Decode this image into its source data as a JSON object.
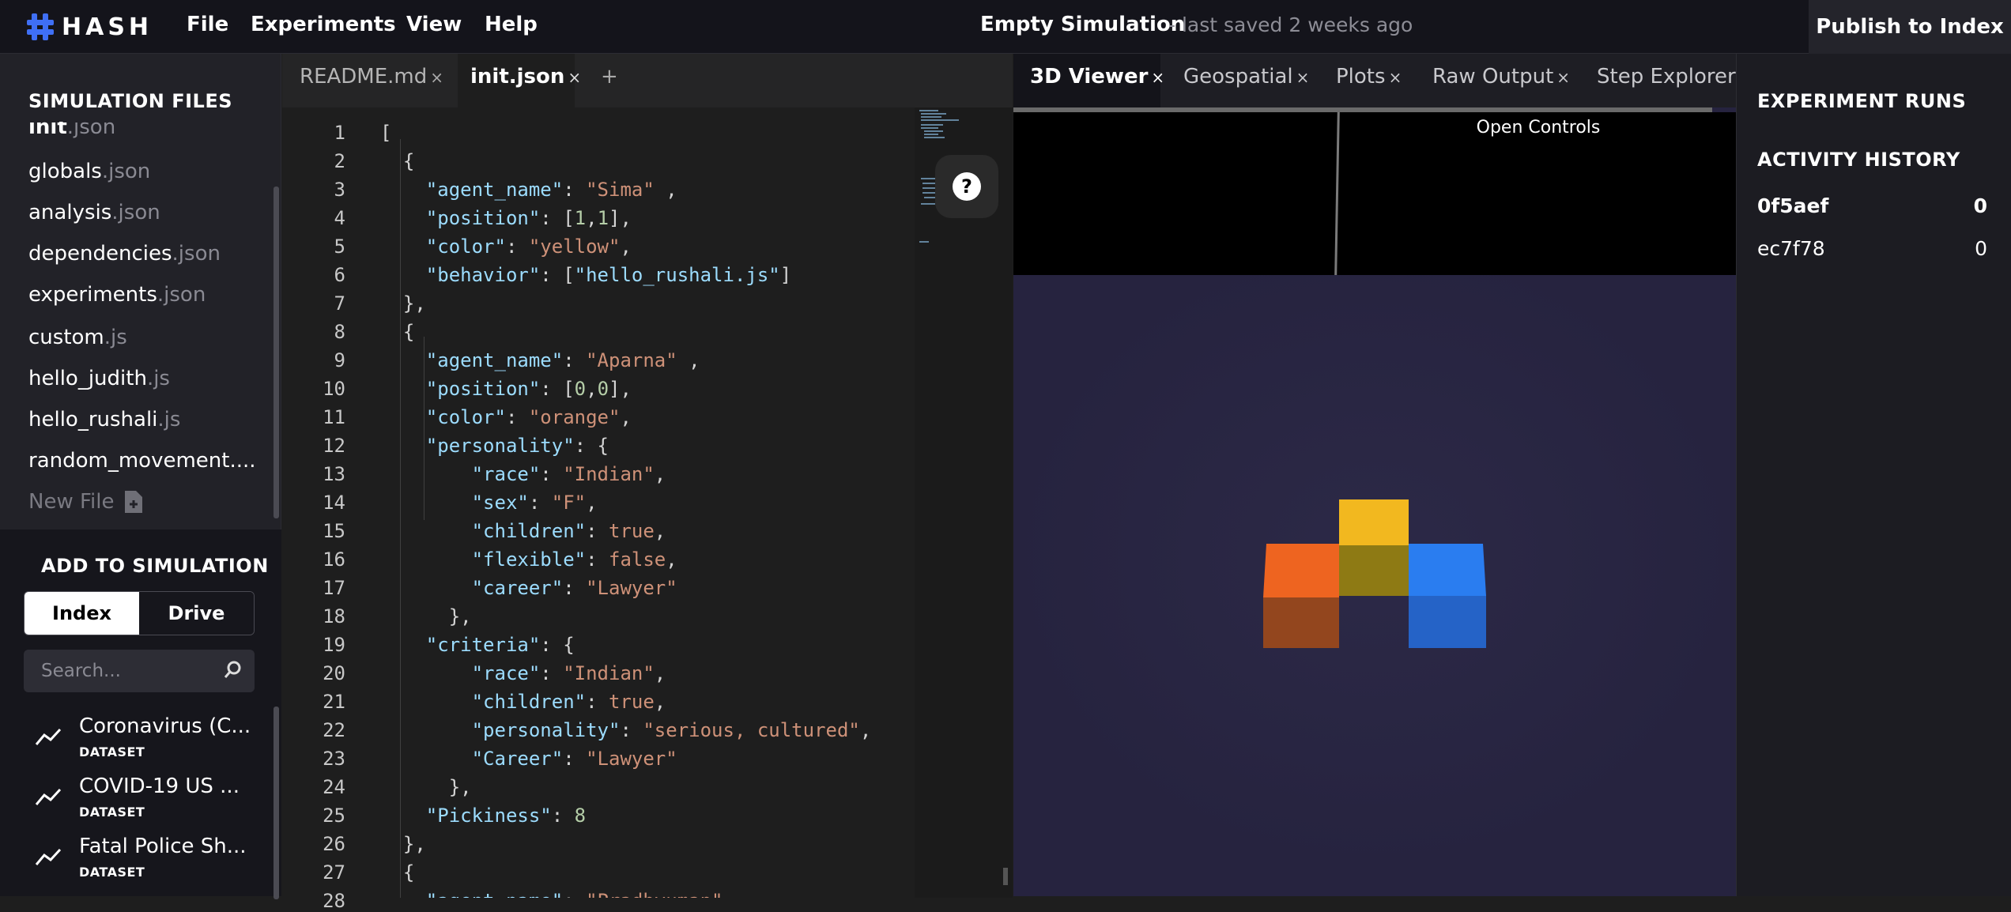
{
  "topbar": {
    "logo_text": "HASH",
    "menu": [
      "File",
      "Experiments",
      "View",
      "Help"
    ],
    "title": "Empty Simulation",
    "saved_text": "- last saved 2 weeks ago",
    "publish_label": "Publish to Index"
  },
  "sidebar": {
    "files_title": "SIMULATION FILES",
    "files": [
      {
        "name": "init",
        "ext": ".json"
      },
      {
        "name": "globals",
        "ext": ".json"
      },
      {
        "name": "analysis",
        "ext": ".json"
      },
      {
        "name": "dependencies",
        "ext": ".json"
      },
      {
        "name": "experiments",
        "ext": ".json"
      },
      {
        "name": "custom",
        "ext": ".js"
      },
      {
        "name": "hello_judith",
        "ext": ".js"
      },
      {
        "name": "hello_rushali",
        "ext": ".js"
      },
      {
        "name": "random_movement....",
        "ext": ""
      }
    ],
    "new_file_label": "New File",
    "add_title": "ADD TO SIMULATION",
    "segment": {
      "index": "Index",
      "drive": "Drive"
    },
    "search_placeholder": "Search...",
    "datasets": [
      {
        "name": "Coronavirus (C...",
        "type": "DATASET"
      },
      {
        "name": "COVID-19 US ...",
        "type": "DATASET"
      },
      {
        "name": "Fatal Police Sh...",
        "type": "DATASET"
      }
    ]
  },
  "editor": {
    "tabs": [
      {
        "label": "README.md",
        "active": false
      },
      {
        "label": "init.json",
        "active": true
      }
    ],
    "add_tab": "+",
    "line_numbers": [
      "1",
      "2",
      "3",
      "4",
      "5",
      "6",
      "7",
      "8",
      "9",
      "10",
      "11",
      "12",
      "13",
      "14",
      "15",
      "16",
      "17",
      "18",
      "19",
      "20",
      "21",
      "22",
      "23",
      "24",
      "25",
      "26",
      "27",
      "28"
    ],
    "help_label": "?"
  },
  "viewer": {
    "tabs": [
      "3D Viewer",
      "Geospatial",
      "Plots",
      "Raw Output",
      "Step Explorer"
    ],
    "open_controls": "Open Controls",
    "cube_colors": {
      "orange": "#e8611c",
      "yellow": "#f2b81f",
      "blue": "#2a7df0"
    }
  },
  "right_panel": {
    "experiment_runs_title": "EXPERIMENT RUNS",
    "activity_title": "ACTIVITY HISTORY",
    "runs": [
      {
        "id": "0f5aef",
        "value": "0"
      },
      {
        "id": "ec7f78",
        "value": "0"
      }
    ]
  }
}
